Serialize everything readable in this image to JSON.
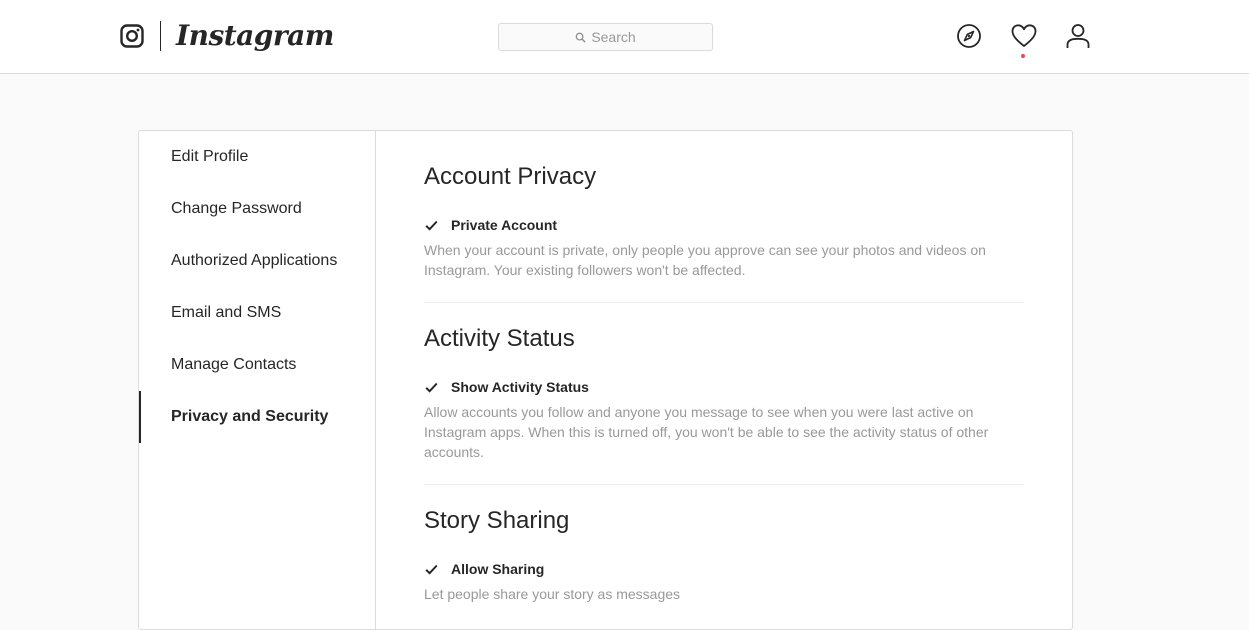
{
  "header": {
    "logo_icon": "instagram-camera-icon",
    "wordmark": "Instagram",
    "search_placeholder": "Search",
    "nav_icons": [
      "compass-icon",
      "heart-icon",
      "user-icon"
    ],
    "notification_dot_color": "#ed4956"
  },
  "sidebar": {
    "items": [
      {
        "label": "Edit Profile",
        "active": false
      },
      {
        "label": "Change Password",
        "active": false
      },
      {
        "label": "Authorized Applications",
        "active": false
      },
      {
        "label": "Email and SMS",
        "active": false
      },
      {
        "label": "Manage Contacts",
        "active": false
      },
      {
        "label": "Privacy and Security",
        "active": true
      }
    ]
  },
  "sections": [
    {
      "title": "Account Privacy",
      "checkbox_label": "Private Account",
      "checked": true,
      "description": "When your account is private, only people you approve can see your photos and videos on Instagram. Your existing followers won't be affected."
    },
    {
      "title": "Activity Status",
      "checkbox_label": "Show Activity Status",
      "checked": true,
      "description": "Allow accounts you follow and anyone you message to see when you were last active on Instagram apps. When this is turned off, you won't be able to see the activity status of other accounts."
    },
    {
      "title": "Story Sharing",
      "checkbox_label": "Allow Sharing",
      "checked": true,
      "description": "Let people share your story as messages"
    }
  ],
  "colors": {
    "text": "#262626",
    "muted": "#999999",
    "border": "#dbdbdb",
    "background": "#fafafa"
  }
}
